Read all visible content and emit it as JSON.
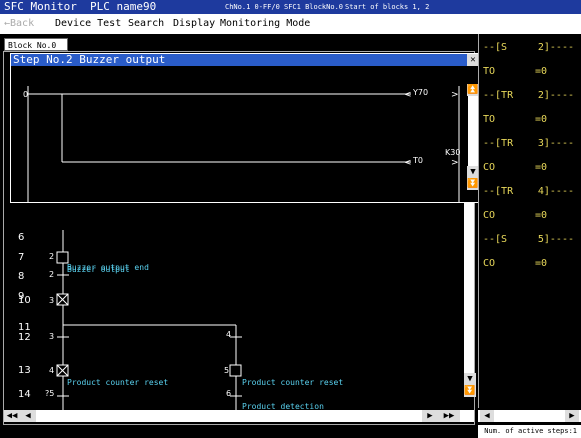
{
  "titlebar": {
    "app": "SFC Monitor",
    "plc": "PLC name90",
    "channel": "ChNo.1 0-FF/0 SFC1 BlockNo.0",
    "blocks": "Start of blocks 1, 2"
  },
  "menubar": {
    "back": "←Back",
    "device_test": "Device Test",
    "search": "Search",
    "display": "Display",
    "monitoring_mode": "Monitoring Mode"
  },
  "block_tab": "Block No.0",
  "popup": {
    "title": "Step No.2 Buzzer output",
    "rung_number": "0",
    "coil1": "Y70",
    "coil2": "T0",
    "coil2_setting": "K30"
  },
  "steps": [
    {
      "num": "6"
    },
    {
      "num": "7",
      "id": "2",
      "label": "Buzzer output"
    },
    {
      "num": "8",
      "id": "2",
      "label": "Buzzer output end"
    },
    {
      "num": "9"
    },
    {
      "num": "10",
      "id": "3"
    },
    {
      "num": "11"
    },
    {
      "num": "12",
      "id": "3",
      "id2": "4"
    },
    {
      "num": "13",
      "id": "4",
      "label": "Product counter reset",
      "id2": "5",
      "label2": "Product counter reset"
    },
    {
      "num": "14",
      "id": "?5",
      "id2": "6",
      "label2": "Product detection"
    }
  ],
  "devices": [
    {
      "left": "--[S",
      "right": "2]----"
    },
    {
      "left": "TO",
      "right": "=0"
    },
    {
      "left": "--[TR",
      "right": "2]----"
    },
    {
      "left": "TO",
      "right": "=0"
    },
    {
      "left": "--[TR",
      "right": "3]----"
    },
    {
      "left": "CO",
      "right": "=0"
    },
    {
      "left": "--[TR",
      "right": "4]----"
    },
    {
      "left": "CO",
      "right": "=0"
    },
    {
      "left": "--[S",
      "right": "5]----"
    },
    {
      "left": "CO",
      "right": "=0"
    }
  ],
  "status": "Num. of active steps:1",
  "colors": {
    "title_bg": "#1e3a9e",
    "popup_title_bg": "#2a5cc8",
    "device_text": "#e8d85a",
    "comment_text": "#5ad2f0"
  }
}
